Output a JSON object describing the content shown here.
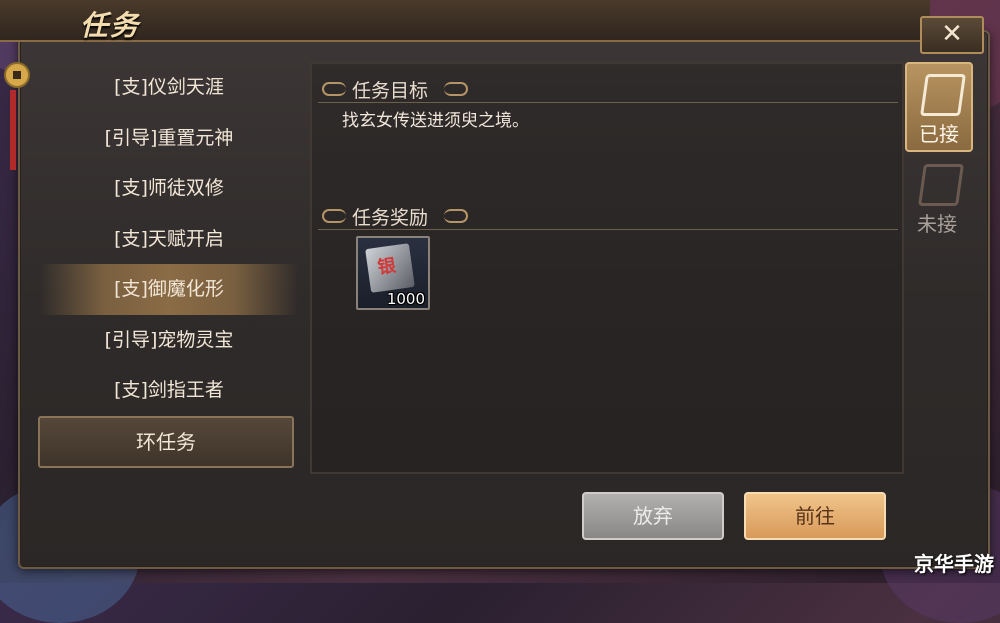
{
  "window": {
    "title": "任务"
  },
  "quest_list": [
    {
      "label": "[支]仪剑天涯",
      "active": false
    },
    {
      "label": "[引导]重置元神",
      "active": false
    },
    {
      "label": "[支]师徒双修",
      "active": false
    },
    {
      "label": "[支]天赋开启",
      "active": false
    },
    {
      "label": "[支]御魔化形",
      "active": true
    },
    {
      "label": "[引导]宠物灵宝",
      "active": false
    },
    {
      "label": "[支]剑指王者",
      "active": false
    }
  ],
  "ring_quest_label": "环任务",
  "goal": {
    "heading": "任务目标",
    "text": "找玄女传送进须臾之境。"
  },
  "reward": {
    "heading": "任务奖励",
    "item": {
      "icon": "silver-scroll-icon",
      "glyph": "银",
      "quantity": "1000"
    }
  },
  "side_tabs": {
    "accepted": "已接",
    "not_accepted": "未接"
  },
  "buttons": {
    "abandon": "放弃",
    "go": "前往"
  },
  "close_label": "✕",
  "watermark": "京华手游"
}
